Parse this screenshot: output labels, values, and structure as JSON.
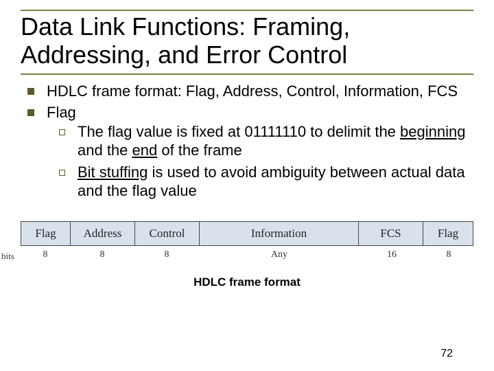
{
  "title": "Data Link Functions: Framing, Addressing, and Error Control",
  "bullets": [
    {
      "text": "HDLC frame format: Flag, Address, Control, Information, FCS"
    },
    {
      "text": "Flag",
      "sub": [
        {
          "pre": "The flag value is fixed at 01111110 to delimit the ",
          "u1": "beginning",
          "mid": " and the ",
          "u2": "end",
          "post": " of the frame"
        },
        {
          "u1": "Bit stuffing",
          "post": " is used to avoid ambiguity between actual data and the flag value"
        }
      ]
    }
  ],
  "diagram": {
    "bits_label": "bits",
    "cols": [
      {
        "name": "Flag",
        "bits": "8"
      },
      {
        "name": "Address",
        "bits": "8"
      },
      {
        "name": "Control",
        "bits": "8"
      },
      {
        "name": "Information",
        "bits": "Any"
      },
      {
        "name": "FCS",
        "bits": "16"
      },
      {
        "name": "Flag",
        "bits": "8"
      }
    ],
    "caption": "HDLC frame format"
  },
  "page": "72"
}
